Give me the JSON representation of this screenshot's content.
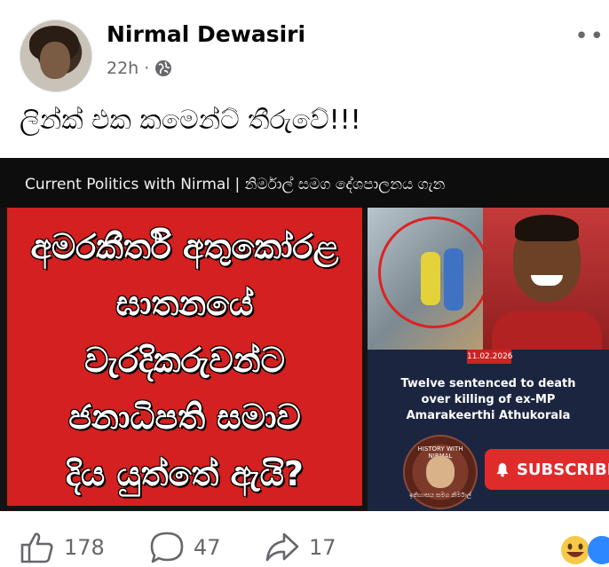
{
  "post": {
    "author": "Nirmal Dewasiri",
    "time": "22h",
    "separator": "·",
    "privacy_icon": "globe-icon",
    "text": "ලින්ක් එක කමෙන්ට් තීරුවේ!!!"
  },
  "image": {
    "banner_text": "Current Politics with Nirmal | නිර්මාල් සමග දේශපාලනය ගැන",
    "headline_lines": [
      "අමරකීර්ති අතුකෝරළ",
      "ඝාතනයේ",
      "වැරදිකරුවන්ට",
      "ජනාධිපති සමාව",
      "දිය යුත්තේ ඇයි?"
    ],
    "date_tag": "11.02.2026",
    "caption_lines": [
      "Twelve sentenced to death",
      "over killing of ex-MP",
      "Amarakeerthi Athukorala"
    ],
    "badge_top": "HISTORY WITH NIRMAL",
    "badge_bottom": "ඉතිහාසය සමග නිර්මාල්",
    "subscribe_label": "SUBSCRIBE"
  },
  "actions": {
    "likes": "178",
    "comments": "47",
    "shares": "17"
  },
  "colors": {
    "accent_red": "#d42020",
    "subscribe_red": "#e02b2b",
    "muted_text": "#65676b"
  }
}
